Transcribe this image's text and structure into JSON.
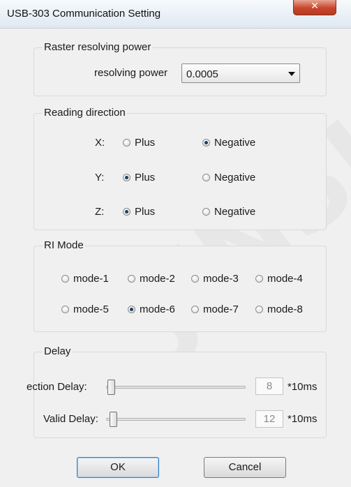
{
  "window": {
    "title": "USB-303 Communication Setting",
    "close_glyph": "✕"
  },
  "watermark": "JINSIZE",
  "raster": {
    "group_label": "Raster resolving power",
    "field_label": "resolving power",
    "selected_value": "0.0005"
  },
  "reading_direction": {
    "group_label": "Reading direction",
    "axes": [
      {
        "label": "X:",
        "plus_label": "Plus",
        "negative_label": "Negative",
        "selected": "Negative"
      },
      {
        "label": "Y:",
        "plus_label": "Plus",
        "negative_label": "Negative",
        "selected": "Plus"
      },
      {
        "label": "Z:",
        "plus_label": "Plus",
        "negative_label": "Negative",
        "selected": "Plus"
      }
    ]
  },
  "ri_mode": {
    "group_label": "RI Mode",
    "modes": [
      "mode-1",
      "mode-2",
      "mode-3",
      "mode-4",
      "mode-5",
      "mode-6",
      "mode-7",
      "mode-8"
    ],
    "selected": "mode-6"
  },
  "delay": {
    "group_label": "Delay",
    "detection": {
      "label": "ection Delay:",
      "value": "8",
      "unit": "*10ms"
    },
    "valid": {
      "label": "Valid Delay:",
      "value": "12",
      "unit": "*10ms"
    }
  },
  "buttons": {
    "ok": "OK",
    "cancel": "Cancel"
  }
}
